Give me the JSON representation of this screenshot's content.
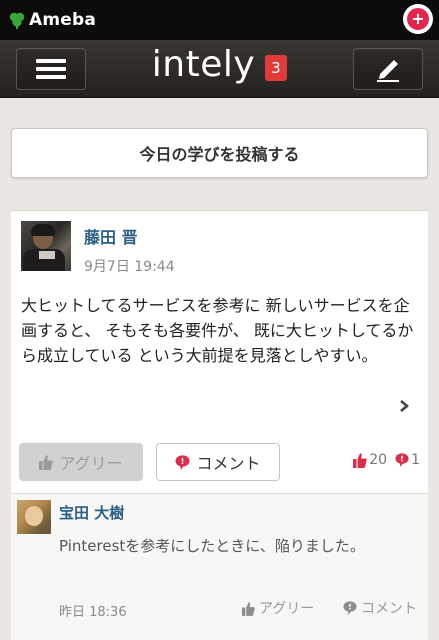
{
  "ameba_bar": {
    "brand": "Ameba",
    "plus_icon": "plus-circle-icon"
  },
  "header": {
    "title": "intely",
    "notification_count": "3",
    "menu_icon": "hamburger-menu-icon",
    "compose_icon": "pencil-icon"
  },
  "post_button": {
    "label": "今日の学びを投稿する"
  },
  "post": {
    "author": "藤田 晋",
    "date": "9月7日 19:44",
    "text": "大ヒットしてるサービスを参考に 新しいサービスを企画すると、 そもそも各要件が、 既に大ヒットしてるから成立している という大前提を見落としやすい。",
    "agree_label": "アグリー",
    "comment_label": "コメント",
    "agree_count": "20",
    "comment_count": "1"
  },
  "comment": {
    "author": "宝田 大樹",
    "text": "Pinterestを参考にしたときに、陥りました。",
    "time": "昨日 18:36",
    "agree_label": "アグリー",
    "comment_label": "コメント"
  },
  "colors": {
    "ameba_green": "#3aa63a",
    "header_dark": "#2b2825",
    "badge_red": "#e03a3a",
    "link_blue": "#2d5f83",
    "accent_red": "#d9304a"
  }
}
